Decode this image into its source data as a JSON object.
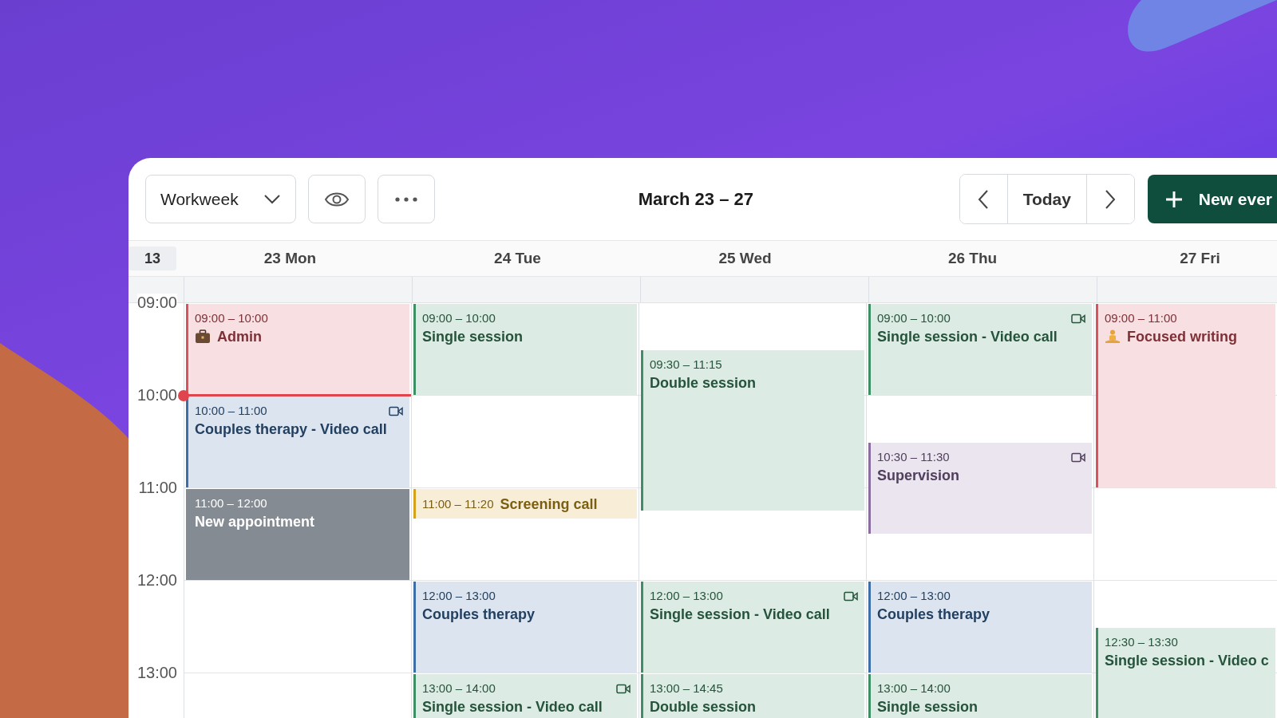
{
  "toolbar": {
    "view_select": {
      "value": "Workweek"
    },
    "title": "March 23 – 27",
    "today_button": "Today",
    "new_button": "New ever"
  },
  "week_number": "13",
  "hours": [
    {
      "label": "09:00",
      "current": false
    },
    {
      "label": "10:00",
      "current": true
    },
    {
      "label": "11:00",
      "current": false
    },
    {
      "label": "12:00",
      "current": false
    },
    {
      "label": "13:00",
      "current": false
    }
  ],
  "days": [
    {
      "label": "23 Mon",
      "today": true,
      "events": [
        {
          "kind": "admin",
          "time": "09:00 – 10:00",
          "title": "Admin",
          "color": "#d9525e",
          "video": false
        },
        {
          "kind": "session",
          "time": "10:00 – 11:00",
          "title": "Couples therapy - Video call",
          "color": "#3d6ea8",
          "video": true
        },
        {
          "kind": "draft",
          "time": "11:00 – 12:00",
          "title": "New appointment",
          "color": "#858b92",
          "video": false
        }
      ]
    },
    {
      "label": "24 Tue",
      "today": false,
      "events": [
        {
          "kind": "session",
          "time": "09:00 – 10:00",
          "title": "Single session",
          "color": "#3f8f66",
          "video": false
        },
        {
          "kind": "session",
          "time": "11:00 – 11:20",
          "title": "Screening call",
          "color": "#d6a21e",
          "video": false
        },
        {
          "kind": "session",
          "time": "12:00 – 13:00",
          "title": "Couples therapy",
          "color": "#3d6ea8",
          "video": false
        },
        {
          "kind": "session",
          "time": "13:00 – 14:00",
          "title": "Single session - Video call",
          "color": "#3f8f66",
          "video": true
        }
      ]
    },
    {
      "label": "25 Wed",
      "today": false,
      "events": [
        {
          "kind": "session",
          "time": "09:30 – 11:15",
          "title": "Double session",
          "color": "#3f8f66",
          "video": false
        },
        {
          "kind": "session",
          "time": "12:00 – 13:00",
          "title": "Single session - Video call",
          "color": "#3f8f66",
          "video": true
        },
        {
          "kind": "session",
          "time": "13:00 – 14:45",
          "title": "Double session",
          "color": "#3f8f66",
          "video": false
        }
      ]
    },
    {
      "label": "26 Thu",
      "today": false,
      "events": [
        {
          "kind": "session",
          "time": "09:00 – 10:00",
          "title": "Single session - Video call",
          "color": "#3f8f66",
          "video": true
        },
        {
          "kind": "session",
          "time": "10:30 – 11:30",
          "title": "Supervision",
          "color": "#8a6ea0",
          "video": true
        },
        {
          "kind": "session",
          "time": "12:00 – 13:00",
          "title": "Couples therapy",
          "color": "#3d6ea8",
          "video": false
        },
        {
          "kind": "session",
          "time": "13:00 – 14:00",
          "title": "Single session",
          "color": "#3f8f66",
          "video": false
        }
      ]
    },
    {
      "label": "27 Fri",
      "today": false,
      "events": [
        {
          "kind": "focus",
          "time": "09:00 – 11:00",
          "title": "Focused writing",
          "color": "#d9525e",
          "video": false
        },
        {
          "kind": "session",
          "time": "12:30 – 13:30",
          "title": "Single session - Video c",
          "color": "#3f8f66",
          "video": false
        }
      ]
    }
  ]
}
